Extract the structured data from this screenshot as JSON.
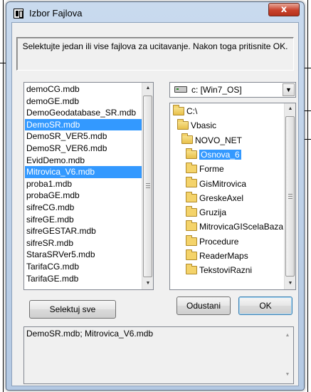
{
  "window": {
    "title": "Izbor Fajlova",
    "close_symbol": "x"
  },
  "message": "Selektujte jedan ili vise fajlova za ucitavanje. Nakon toga pritisnite OK.",
  "files": [
    {
      "name": "demoCG.mdb",
      "selected": false
    },
    {
      "name": "demoGE.mdb",
      "selected": false
    },
    {
      "name": "DemoGeodatabase_SR.mdb",
      "selected": false
    },
    {
      "name": "DemoSR.mdb",
      "selected": true
    },
    {
      "name": "DemoSR_VER5.mdb",
      "selected": false
    },
    {
      "name": "DemoSR_VER6.mdb",
      "selected": false
    },
    {
      "name": "EvidDemo.mdb",
      "selected": false
    },
    {
      "name": "Mitrovica_V6.mdb",
      "selected": true
    },
    {
      "name": "proba1.mdb",
      "selected": false
    },
    {
      "name": "probaGE.mdb",
      "selected": false
    },
    {
      "name": "sifreCG.mdb",
      "selected": false
    },
    {
      "name": "sifreGE.mdb",
      "selected": false
    },
    {
      "name": "sifreGESTAR.mdb",
      "selected": false
    },
    {
      "name": "sifreSR.mdb",
      "selected": false
    },
    {
      "name": "StaraSRVer5.mdb",
      "selected": false
    },
    {
      "name": "TarifaCG.mdb",
      "selected": false
    },
    {
      "name": "TarifaGE.mdb",
      "selected": false
    }
  ],
  "drive": {
    "label": "c: [Win7_OS]",
    "icon": "hard-drive-icon"
  },
  "directories": [
    {
      "name": "C:\\",
      "open": true,
      "selected": false,
      "level": 0
    },
    {
      "name": "Vbasic",
      "open": true,
      "selected": false,
      "level": 1
    },
    {
      "name": "NOVO_NET",
      "open": true,
      "selected": false,
      "level": 2
    },
    {
      "name": "Osnova_6",
      "open": true,
      "selected": true,
      "level": 3
    },
    {
      "name": "Forme",
      "open": false,
      "selected": false,
      "level": 4
    },
    {
      "name": "GisMitrovica",
      "open": false,
      "selected": false,
      "level": 4
    },
    {
      "name": "GreskeAxel",
      "open": false,
      "selected": false,
      "level": 4
    },
    {
      "name": "Gruzija",
      "open": false,
      "selected": false,
      "level": 4
    },
    {
      "name": "MitrovicaGIScelaBaza",
      "open": false,
      "selected": false,
      "level": 4
    },
    {
      "name": "Procedure",
      "open": false,
      "selected": false,
      "level": 4
    },
    {
      "name": "ReaderMaps",
      "open": false,
      "selected": false,
      "level": 4
    },
    {
      "name": "TekstoviRazni",
      "open": false,
      "selected": false,
      "level": 4
    }
  ],
  "buttons": {
    "select_all": "Selektuj sve",
    "cancel": "Odustani",
    "ok": "OK"
  },
  "result": "DemoSR.mdb; Mitrovica_V6.mdb",
  "scroll": {
    "up": "▲",
    "down": "▼"
  }
}
